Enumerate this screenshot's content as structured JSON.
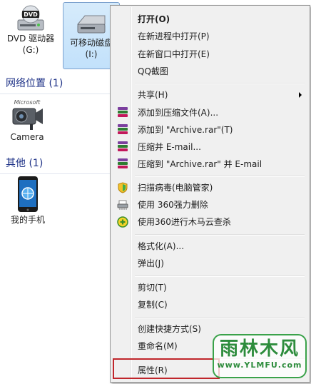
{
  "drives": [
    {
      "label_line1": "DVD 驱动器",
      "label_line2": "(G:)",
      "icon": "dvd-drive-icon",
      "selected": false
    },
    {
      "label_line1": "可移动磁盘",
      "label_line2": "(I:)",
      "icon": "removable-disk-icon",
      "selected": true
    }
  ],
  "groups": {
    "network": {
      "header": "网络位置 (1)",
      "items": [
        {
          "label": "Camera",
          "icon": "camera-icon"
        }
      ]
    },
    "other": {
      "header": "其他 (1)",
      "items": [
        {
          "label": "我的手机",
          "icon": "phone-icon"
        }
      ]
    }
  },
  "context_menu": {
    "items": [
      {
        "id": "open",
        "label": "打开(O)",
        "bold": true
      },
      {
        "id": "open-new-process",
        "label": "在新进程中打开(P)"
      },
      {
        "id": "open-new-window",
        "label": "在新窗口中打开(E)"
      },
      {
        "id": "qq-screenshot",
        "label": "QQ截图"
      },
      {
        "id": "share",
        "label": "共享(H)",
        "submenu": true
      },
      {
        "id": "add-to-archive",
        "label": "添加到压缩文件(A)...",
        "icon": "winrar-icon"
      },
      {
        "id": "add-to-archive-rar",
        "label": "添加到 \"Archive.rar\"(T)",
        "icon": "winrar-icon"
      },
      {
        "id": "compress-email",
        "label": "压缩并 E-mail...",
        "icon": "winrar-icon"
      },
      {
        "id": "compress-rar-email",
        "label": "压缩到 \"Archive.rar\" 并 E-mail",
        "icon": "winrar-icon"
      },
      {
        "id": "virus-scan",
        "label": "扫描病毒(电脑管家)",
        "icon": "shield-icon"
      },
      {
        "id": "360-delete",
        "label": "使用 360强力删除",
        "icon": "shredder-icon"
      },
      {
        "id": "360-cloud-scan",
        "label": "使用360进行木马云查杀",
        "icon": "360-plus-icon"
      },
      {
        "id": "format",
        "label": "格式化(A)..."
      },
      {
        "id": "eject",
        "label": "弹出(J)"
      },
      {
        "id": "cut",
        "label": "剪切(T)"
      },
      {
        "id": "copy",
        "label": "复制(C)"
      },
      {
        "id": "create-shortcut",
        "label": "创建快捷方式(S)"
      },
      {
        "id": "rename",
        "label": "重命名(M)"
      },
      {
        "id": "properties",
        "label": "属性(R)",
        "highlighted": true
      }
    ]
  },
  "watermark": {
    "title": "雨林木风",
    "url": "www.YLMFU.com"
  },
  "colors": {
    "highlight_border": "#c0262b",
    "selection_fill": "#cde6fb",
    "group_header": "#1e3287"
  }
}
